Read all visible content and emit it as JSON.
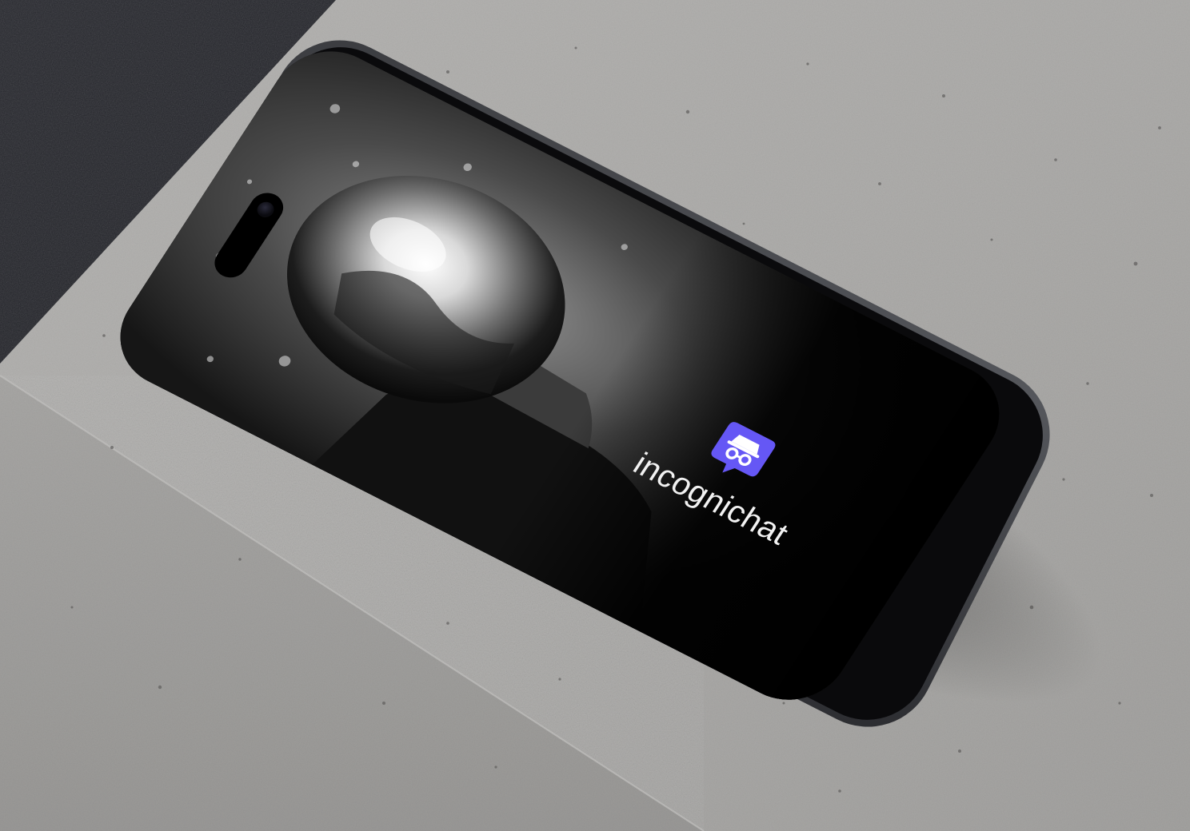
{
  "app": {
    "name": "incognichat"
  },
  "icons": {
    "app_logo": "incognito-chat-bubble-icon"
  },
  "colors": {
    "brand": "#6557f5",
    "brand_dark": "#4e41e0",
    "text_on_dark": "#f2f2f2",
    "concrete": "#a9a9a8",
    "backdrop": "#1a1b20"
  }
}
